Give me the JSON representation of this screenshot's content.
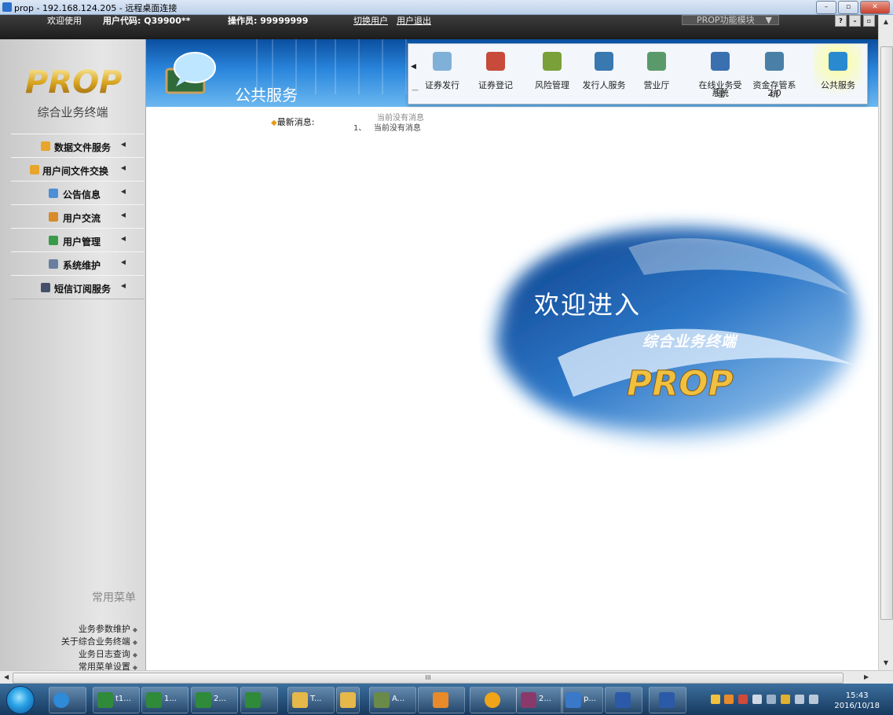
{
  "window": {
    "title": "prop - 192.168.124.205 - 远程桌面连接",
    "buttons": {
      "minimize": "–",
      "restore": "▫",
      "close": "✕"
    }
  },
  "infobar": {
    "welcome": "欢迎使用",
    "user_code": "用户代码: Q39900**",
    "operator": "操作员: 99999999",
    "switch_user": "切换用户",
    "logout": "用户退出",
    "module_select": "PROP功能模块",
    "mini_buttons": [
      "?",
      "–",
      "▫"
    ]
  },
  "sidebar": {
    "logo_alt": "PROP",
    "subtitle": "综合业务终端",
    "menu": [
      {
        "label": "数据文件服务",
        "icon": "folder-icon",
        "color": "#e8a52a"
      },
      {
        "label": "用户间文件交换",
        "icon": "folder-exchange-icon",
        "color": "#e8a52a"
      },
      {
        "label": "公告信息",
        "icon": "speech-bubble-icon",
        "color": "#4c8fd6"
      },
      {
        "label": "用户交流",
        "icon": "users-icon",
        "color": "#d98a2a"
      },
      {
        "label": "用户管理",
        "icon": "user-manage-icon",
        "color": "#3a9a4a"
      },
      {
        "label": "系统维护",
        "icon": "wrench-icon",
        "color": "#6a7fa0"
      },
      {
        "label": "短信订阅服务",
        "icon": "phone-icon",
        "color": "#44506a"
      }
    ],
    "common_menu_title": "常用菜单",
    "common_links": [
      "业务参数维护",
      "关于综合业务终端",
      "业务日志查询",
      "常用菜单设置"
    ]
  },
  "banner": {
    "title": "公共服务",
    "icon": "speech-board-icon"
  },
  "toolbar": {
    "items": [
      {
        "label": "证券发行",
        "label2": "",
        "icon": "chart-icon",
        "color": "#7fb0d8"
      },
      {
        "label": "证券登记",
        "label2": "",
        "icon": "pen-icon",
        "color": "#c84a3a"
      },
      {
        "label": "风险管理",
        "label2": "",
        "icon": "risk-icon",
        "color": "#7aa03a"
      },
      {
        "label": "发行人服务",
        "label2": "",
        "icon": "issuer-icon",
        "color": "#3a78b0"
      },
      {
        "label": "营业厅",
        "label2": "",
        "icon": "hall-icon",
        "color": "#5a9a6a"
      },
      {
        "label": "在线业务受理",
        "label2": "系统",
        "icon": "online-icon",
        "color": "#3a6fb0"
      },
      {
        "label": "资金存管系统",
        "label2": "2.0",
        "icon": "fund-icon",
        "color": "#4a80a8"
      },
      {
        "label": "公共服务",
        "label2": "",
        "icon": "public-service-icon",
        "color": "#2a8ad0"
      }
    ],
    "active_index": 7
  },
  "news": {
    "label": "最新消息:",
    "ghost": "当前没有消息",
    "items": [
      {
        "num": "1、",
        "text": "当前没有消息"
      }
    ]
  },
  "welcome": {
    "line1": "欢迎进入",
    "line2": "综合业务终端",
    "logo": "PROP"
  },
  "hscroll": {
    "grip": "III"
  },
  "taskbar": {
    "tasks": [
      {
        "label": "",
        "icon": "ie-icon",
        "color": "#2f8ad8"
      },
      {
        "label": "t1...",
        "icon": "excel-icon",
        "color": "#2f8a3a"
      },
      {
        "label": "1...",
        "icon": "excel-icon",
        "color": "#2f8a3a"
      },
      {
        "label": "2...",
        "icon": "excel-icon",
        "color": "#2f8a3a"
      },
      {
        "label": "",
        "icon": "excel-icon",
        "color": "#2f8a3a"
      },
      {
        "label": "T...",
        "icon": "folder-icon",
        "color": "#e6b84a"
      },
      {
        "label": "",
        "icon": "folder-icon",
        "color": "#e6b84a"
      },
      {
        "label": "A...",
        "icon": "app-icon",
        "color": "#6a8a4a"
      },
      {
        "label": "",
        "icon": "outlook-icon",
        "color": "#e88a2a"
      },
      {
        "label": "",
        "icon": "chat-icon",
        "color": "#f0a41a"
      },
      {
        "label": "2...",
        "icon": "winrar-icon",
        "color": "#8a3a6a"
      },
      {
        "label": "p...",
        "icon": "remote-desktop-icon",
        "color": "#3a78c8"
      },
      {
        "label": "",
        "icon": "word-icon",
        "color": "#2a5aa8"
      },
      {
        "label": "",
        "icon": "word-icon",
        "color": "#2a5aa8"
      }
    ],
    "clock_time": "15:43",
    "clock_date": "2016/10/18"
  }
}
